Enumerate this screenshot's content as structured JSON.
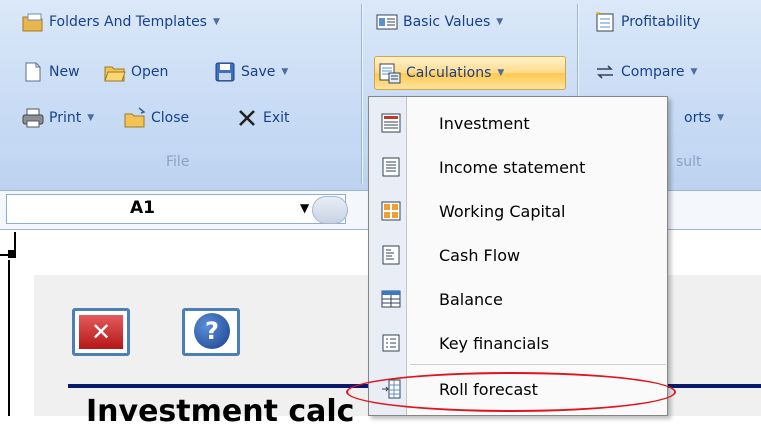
{
  "ribbon": {
    "file_group": {
      "folders_label": "Folders And Templates",
      "new_label": "New",
      "open_label": "Open",
      "save_label": "Save",
      "print_label": "Print",
      "close_label": "Close",
      "exit_label": "Exit",
      "group_label": "File"
    },
    "calc_group": {
      "basic_values_label": "Basic Values",
      "calculations_label": "Calculations"
    },
    "result_group": {
      "profitability_label": "Profitability",
      "compare_label": "Compare",
      "reports_label_partial": "orts",
      "group_label_partial": "sult"
    }
  },
  "formula_bar": {
    "name_box_value": "A1"
  },
  "sheet": {
    "title_partial": "Investment calc"
  },
  "menu": {
    "items": [
      {
        "label": "Investment",
        "icon": "investment-icon"
      },
      {
        "label": "Income statement",
        "icon": "income-statement-icon"
      },
      {
        "label": "Working Capital",
        "icon": "working-capital-icon"
      },
      {
        "label": "Cash Flow",
        "icon": "cash-flow-icon"
      },
      {
        "label": "Balance",
        "icon": "balance-icon"
      },
      {
        "label": "Key financials",
        "icon": "key-financials-icon"
      },
      {
        "label": "Roll forecast",
        "icon": "roll-forecast-icon"
      }
    ]
  },
  "colors": {
    "ribbon_bg": "#c9dcf5",
    "ribbon_text": "#15428b",
    "highlight": "#ffc94d",
    "annotation_red": "#e0141e",
    "navy_line": "#0a1a6b"
  }
}
